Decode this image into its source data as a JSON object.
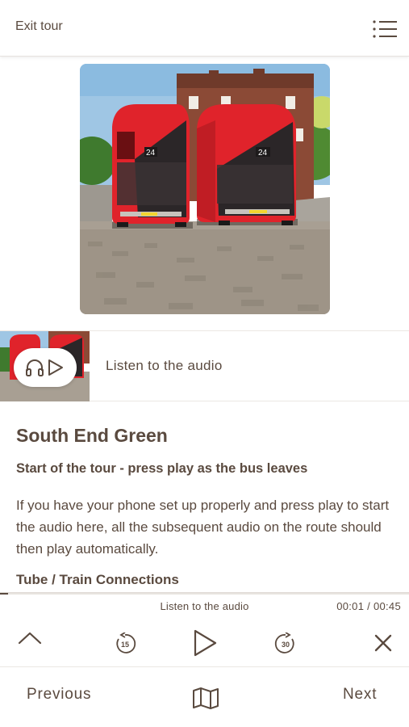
{
  "header": {
    "exit_label": "Exit tour"
  },
  "audio_strip": {
    "label": "Listen to the audio"
  },
  "stop": {
    "title": "South End Green",
    "subtitle": "Start of the tour - press play as the bus leaves",
    "body": "If you have your phone set up properly and press play to start the audio here, all the subsequent audio on the route should then play automatically.",
    "section_heading": "Tube / Train Connections"
  },
  "player": {
    "title": "Listen to the audio",
    "time": "00:01 / 00:45",
    "progress_fraction": 0.02,
    "rewind_seconds": "15",
    "forward_seconds": "30"
  },
  "bottom_nav": {
    "previous_label": "Previous",
    "next_label": "Next"
  },
  "colors": {
    "text": "#5a4a3f",
    "bus_red": "#e0232b",
    "divider": "#ebe7e3"
  }
}
